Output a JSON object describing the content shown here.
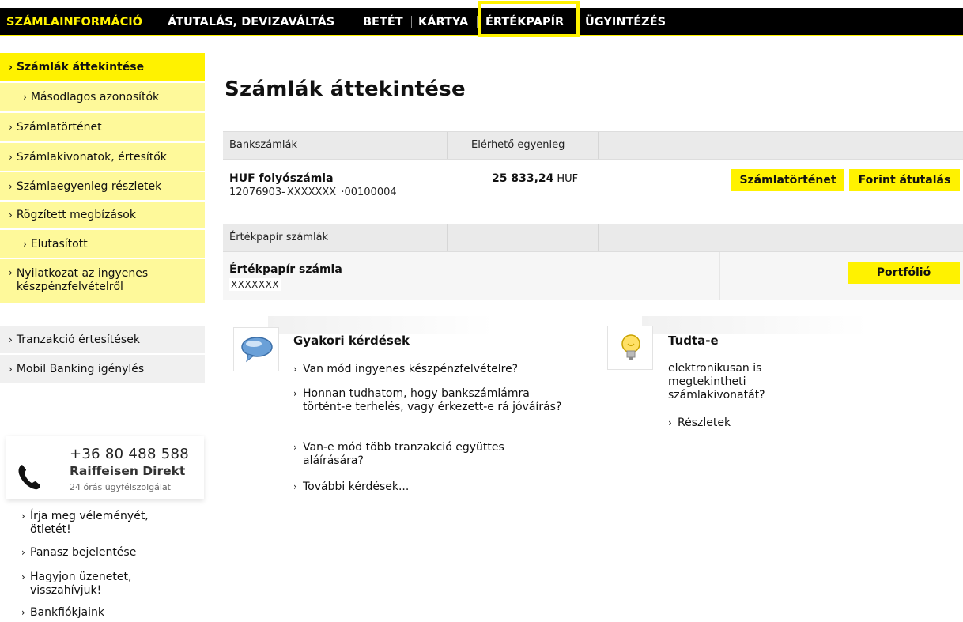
{
  "topnav": {
    "items": [
      "SZÁMLAINFORMÁCIÓ",
      "ÁTUTALÁS, DEVIZAVÁLTÁS",
      "BETÉT",
      "KÁRTYA",
      "ÉRTÉKPAPÍR",
      "ÜGYINTÉZÉS"
    ],
    "active": "SZÁMLAINFORMÁCIÓ",
    "highlighted": "ÉRTÉKPAPÍR"
  },
  "sidebar": {
    "items": [
      "Számlák áttekintése",
      "Másodlagos azonosítók",
      "Számlatörténet",
      "Számlakivonatok, értesítők",
      "Számlaegyenleg részletek",
      "Rögzített megbízások",
      "Elutasított",
      "Nyilatkozat az ingyenes készpénzfelvételről"
    ],
    "items2": [
      "Tranzakció értesítések",
      "Mobil Banking igénylés"
    ]
  },
  "direkt": {
    "phone": "+36 80 488 588",
    "name": "Raiffeisen Direkt",
    "hours": "24 órás ügyfélszolgálat"
  },
  "contact_links": [
    "Írja meg véleményét, ötletét!",
    "Panasz bejelentése",
    "Hagyjon üzenetet, visszahívjuk!",
    "Bankfiókjaink"
  ],
  "main": {
    "title": "Számlák áttekintése",
    "bank_header": {
      "col1": "Bankszámlák",
      "col2": "Elérhető egyenleg"
    },
    "bank_account": {
      "name": "HUF folyószámla",
      "number_prefix": "12076903-",
      "number_masked": "XXXXXXX",
      "number_suffix": "·00100004",
      "balance": "25 833,24",
      "currency": "HUF",
      "btn_history": "Számlatörténet",
      "btn_transfer": "Forint átutalás"
    },
    "sec_header": {
      "col1": "Értékpapír számlák"
    },
    "sec_account": {
      "name": "Értékpapír számla",
      "number_masked": "XXXXXXX",
      "btn_portfolio": "Portfólió"
    }
  },
  "faq": {
    "title": "Gyakori kérdések",
    "links": [
      "Van mód ingyenes készpénzfelvételre?",
      "Honnan tudhatom, hogy bankszámlámra történt-e terhelés, vagy érkezett-e rá jóváírás?",
      "Van-e mód több tranzakció együttes aláírására?",
      "További kérdések..."
    ]
  },
  "tip": {
    "title": "Tudta-e",
    "text": "elektronikusan is megtekintheti számlakivonatát?",
    "link": "Részletek"
  },
  "colors": {
    "accent": "#fff200",
    "sidebar": "#fef99a",
    "nav_bg": "#000000"
  }
}
